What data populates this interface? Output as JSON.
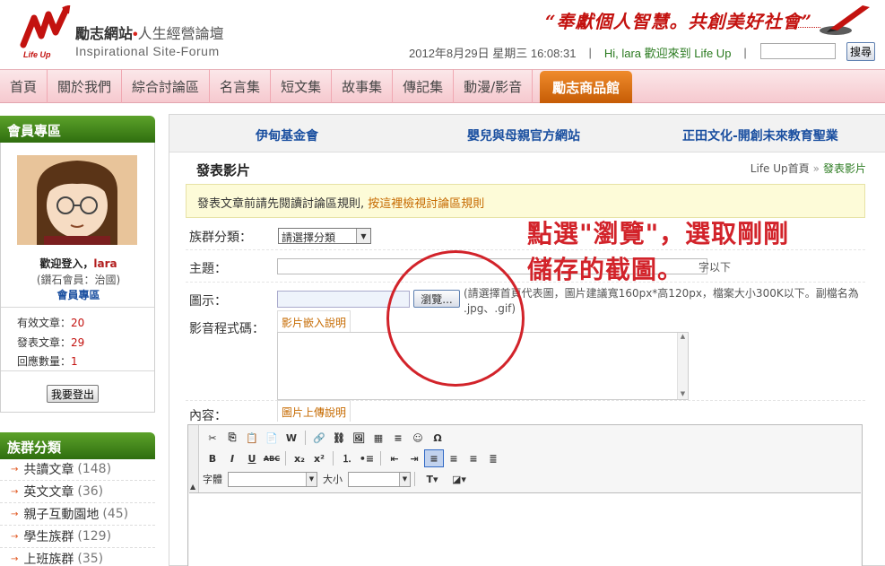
{
  "header": {
    "logo_sub": "Life Up",
    "site_name": "勵志網站",
    "site_dot": "•",
    "site_tagline": "人生經營論壇",
    "site_subtitle": "Inspirational Site-Forum",
    "slogan": "“奉獻個人智慧。共創美好社會”",
    "datetime": "2012年8月29日 星期三 16:08:31",
    "separator": "|",
    "welcome": "Hi, lara 歡迎來到 Life Up",
    "search_button": "搜尋"
  },
  "nav": {
    "items": [
      "首頁",
      "關於我們",
      "綜合討論區",
      "名言集",
      "短文集",
      "故事集",
      "傳記集",
      "動漫/影音"
    ],
    "active": "勵志商品館"
  },
  "sidebar": {
    "member_title": "會員專區",
    "greet_prefix": "歡迎登入，",
    "username": "lara",
    "rank": "(鑽石會員：治國)",
    "member_link": "會員專區",
    "stats": [
      {
        "label": "有效文章：",
        "value": "20"
      },
      {
        "label": "發表文章：",
        "value": "29"
      },
      {
        "label": "回應數量：",
        "value": "1"
      }
    ],
    "logout": "我要登出",
    "groups_title": "族群分類",
    "groups": [
      {
        "name": "共讀文章",
        "count": "(148)"
      },
      {
        "name": "英文文章",
        "count": "(36)"
      },
      {
        "name": "親子互動園地",
        "count": "(45)"
      },
      {
        "name": "學生族群",
        "count": "(129)"
      },
      {
        "name": "上班族群",
        "count": "(35)"
      }
    ]
  },
  "main": {
    "partners": [
      "伊甸基金會",
      "嬰兒與母親官方網站",
      "正田文化-開創未來教育聖業"
    ],
    "page_title": "發表影片",
    "breadcrumb_home": "Life Up首頁",
    "breadcrumb_sep": "»",
    "breadcrumb_current": "發表影片",
    "notice_text": "發表文章前請先閱讀討論區規則, ",
    "notice_link": "按這裡檢視討論區規則",
    "form": {
      "group_label": "族群分類：",
      "group_select": "請選擇分類",
      "subject_label": "主題：",
      "subject_hint": "字以下",
      "icon_label": "圖示：",
      "browse_button": "瀏覽...",
      "icon_hint": "(請選擇首頁代表圖，圖片建議寬160px*高120px，檔案大小300K以下。副檔名為 .jpg、.gif)",
      "video_label": "影音程式碼：",
      "video_tab": "影片嵌入說明",
      "content_label": "內容：",
      "content_tab": "圖片上傳說明"
    },
    "editor": {
      "font_label": "字體",
      "size_label": "大小"
    }
  },
  "annotation": {
    "text": "點選\"瀏覽\"，選取剛剛儲存的截圖。",
    "color": "#d2232a"
  }
}
